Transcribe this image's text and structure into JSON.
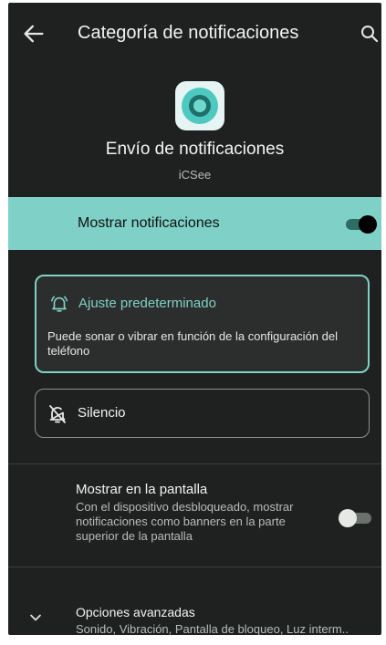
{
  "header": {
    "title": "Categoría de notificaciones",
    "back_icon": "arrow-left-icon",
    "search_icon": "search-icon"
  },
  "app": {
    "channel_name": "Envío de notificaciones",
    "app_name": "iCSee",
    "icon": "camera-lens-icon"
  },
  "show_notifications": {
    "label": "Mostrar notificaciones",
    "enabled": true
  },
  "behavior": {
    "default": {
      "title": "Ajuste predeterminado",
      "description": "Puede sonar o vibrar en función de la configuración del teléfono",
      "selected": true,
      "icon": "bell-ring-icon"
    },
    "silent": {
      "title": "Silencio",
      "selected": false,
      "icon": "bell-off-icon"
    }
  },
  "popup": {
    "title": "Mostrar en la pantalla",
    "subtitle": "Con el dispositivo desbloqueado, mostrar notificaciones como banners en la parte superior de la pantalla",
    "enabled": false
  },
  "advanced": {
    "title": "Opciones avanzadas",
    "subtitle": "Sonido, Vibración, Pantalla de bloqueo, Luz interm..",
    "icon": "chevron-down-icon"
  },
  "colors": {
    "background": "#1f2120",
    "accent": "#7fd0c6",
    "card": "#2b2e2c"
  }
}
